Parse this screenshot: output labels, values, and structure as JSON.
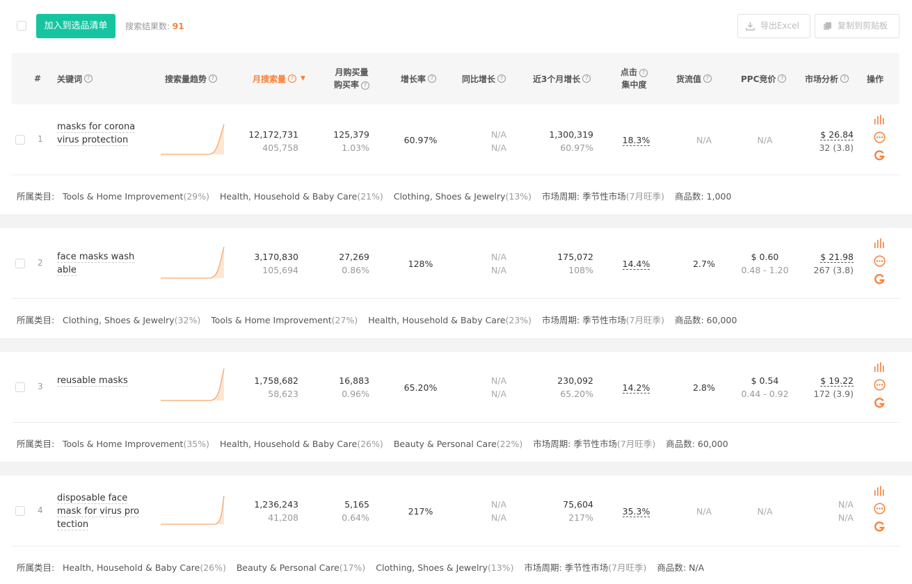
{
  "toolbar": {
    "add_button": "加入到选品清单",
    "result_label": "搜索结果数:",
    "result_count": "91",
    "export_label": "导出Excel",
    "copy_label": "复制到剪贴板"
  },
  "headers": {
    "rank": "#",
    "keyword": "关键词",
    "trend": "搜索量趋势",
    "monthly_search": "月搜索量",
    "monthly_purchase_l1": "月购买量",
    "monthly_purchase_l2": "购买率",
    "growth": "增长率",
    "yoy": "同比增长",
    "three_month": "近3个月增长",
    "click_l1": "点击",
    "click_l2": "集中度",
    "goods_value": "货流值",
    "ppc": "PPC竞价",
    "market": "市场分析",
    "actions": "操作"
  },
  "meta_labels": {
    "category": "所属类目:",
    "cycle": "市场周期:",
    "products": "商品数:"
  },
  "rows": [
    {
      "rank": "1",
      "keyword_l1": "masks for corona",
      "keyword_l2": "virus protection",
      "keyword_l3": "",
      "search": "12,172,731",
      "search_sub": "405,758",
      "purchase": "125,379",
      "purchase_rate": "1.03%",
      "growth": "60.97%",
      "yoy_1": "N/A",
      "yoy_2": "N/A",
      "three_m": "1,300,319",
      "three_m_sub": "60.97%",
      "click": "18.3%",
      "goods_value": "N/A",
      "ppc": "N/A",
      "ppc_sub": "",
      "market_price": "$ 26.84",
      "market_sub": "32 (3.8)",
      "categories": [
        {
          "name": "Tools & Home Improvement",
          "pct": "(29%)"
        },
        {
          "name": "Health, Household & Baby Care",
          "pct": "(21%)"
        },
        {
          "name": "Clothing, Shoes & Jewelry",
          "pct": "(13%)"
        }
      ],
      "cycle": "季节性市场",
      "cycle_sub": "(7月旺季)",
      "products": "1,000"
    },
    {
      "rank": "2",
      "keyword_l1": "face masks wash",
      "keyword_l2": "able",
      "keyword_l3": "",
      "search": "3,170,830",
      "search_sub": "105,694",
      "purchase": "27,269",
      "purchase_rate": "0.86%",
      "growth": "128%",
      "yoy_1": "N/A",
      "yoy_2": "N/A",
      "three_m": "175,072",
      "three_m_sub": "108%",
      "click": "14.4%",
      "goods_value": "2.7%",
      "ppc": "$ 0.60",
      "ppc_sub": "0.48 - 1.20",
      "market_price": "$ 21.98",
      "market_sub": "267 (3.8)",
      "categories": [
        {
          "name": "Clothing, Shoes & Jewelry",
          "pct": "(32%)"
        },
        {
          "name": "Tools & Home Improvement",
          "pct": "(27%)"
        },
        {
          "name": "Health, Household & Baby Care",
          "pct": "(23%)"
        }
      ],
      "cycle": "季节性市场",
      "cycle_sub": "(7月旺季)",
      "products": "60,000"
    },
    {
      "rank": "3",
      "keyword_l1": "reusable masks",
      "keyword_l2": "",
      "keyword_l3": "",
      "search": "1,758,682",
      "search_sub": "58,623",
      "purchase": "16,883",
      "purchase_rate": "0.96%",
      "growth": "65.20%",
      "yoy_1": "N/A",
      "yoy_2": "N/A",
      "three_m": "230,092",
      "three_m_sub": "65.20%",
      "click": "14.2%",
      "goods_value": "2.8%",
      "ppc": "$ 0.54",
      "ppc_sub": "0.44 - 0.92",
      "market_price": "$ 19.22",
      "market_sub": "172 (3.9)",
      "categories": [
        {
          "name": "Tools & Home Improvement",
          "pct": "(35%)"
        },
        {
          "name": "Health, Household & Baby Care",
          "pct": "(26%)"
        },
        {
          "name": "Beauty & Personal Care",
          "pct": "(22%)"
        }
      ],
      "cycle": "季节性市场",
      "cycle_sub": "(7月旺季)",
      "products": "60,000"
    },
    {
      "rank": "4",
      "keyword_l1": "disposable face",
      "keyword_l2": "mask for virus pro",
      "keyword_l3": "tection",
      "search": "1,236,243",
      "search_sub": "41,208",
      "purchase": "5,165",
      "purchase_rate": "0.64%",
      "growth": "217%",
      "yoy_1": "N/A",
      "yoy_2": "N/A",
      "three_m": "75,604",
      "three_m_sub": "217%",
      "click": "35.3%",
      "goods_value": "N/A",
      "ppc": "N/A",
      "ppc_sub": "",
      "market_price": "N/A",
      "market_sub": "N/A",
      "categories": [
        {
          "name": "Health, Household & Baby Care",
          "pct": "(26%)"
        },
        {
          "name": "Beauty & Personal Care",
          "pct": "(17%)"
        },
        {
          "name": "Clothing, Shoes & Jewelry",
          "pct": "(13%)"
        }
      ],
      "cycle": "季节性市场",
      "cycle_sub": "(7月旺季)",
      "products": "N/A"
    }
  ],
  "colors": {
    "primary": "#16c4a0",
    "accent": "#f7813a"
  }
}
